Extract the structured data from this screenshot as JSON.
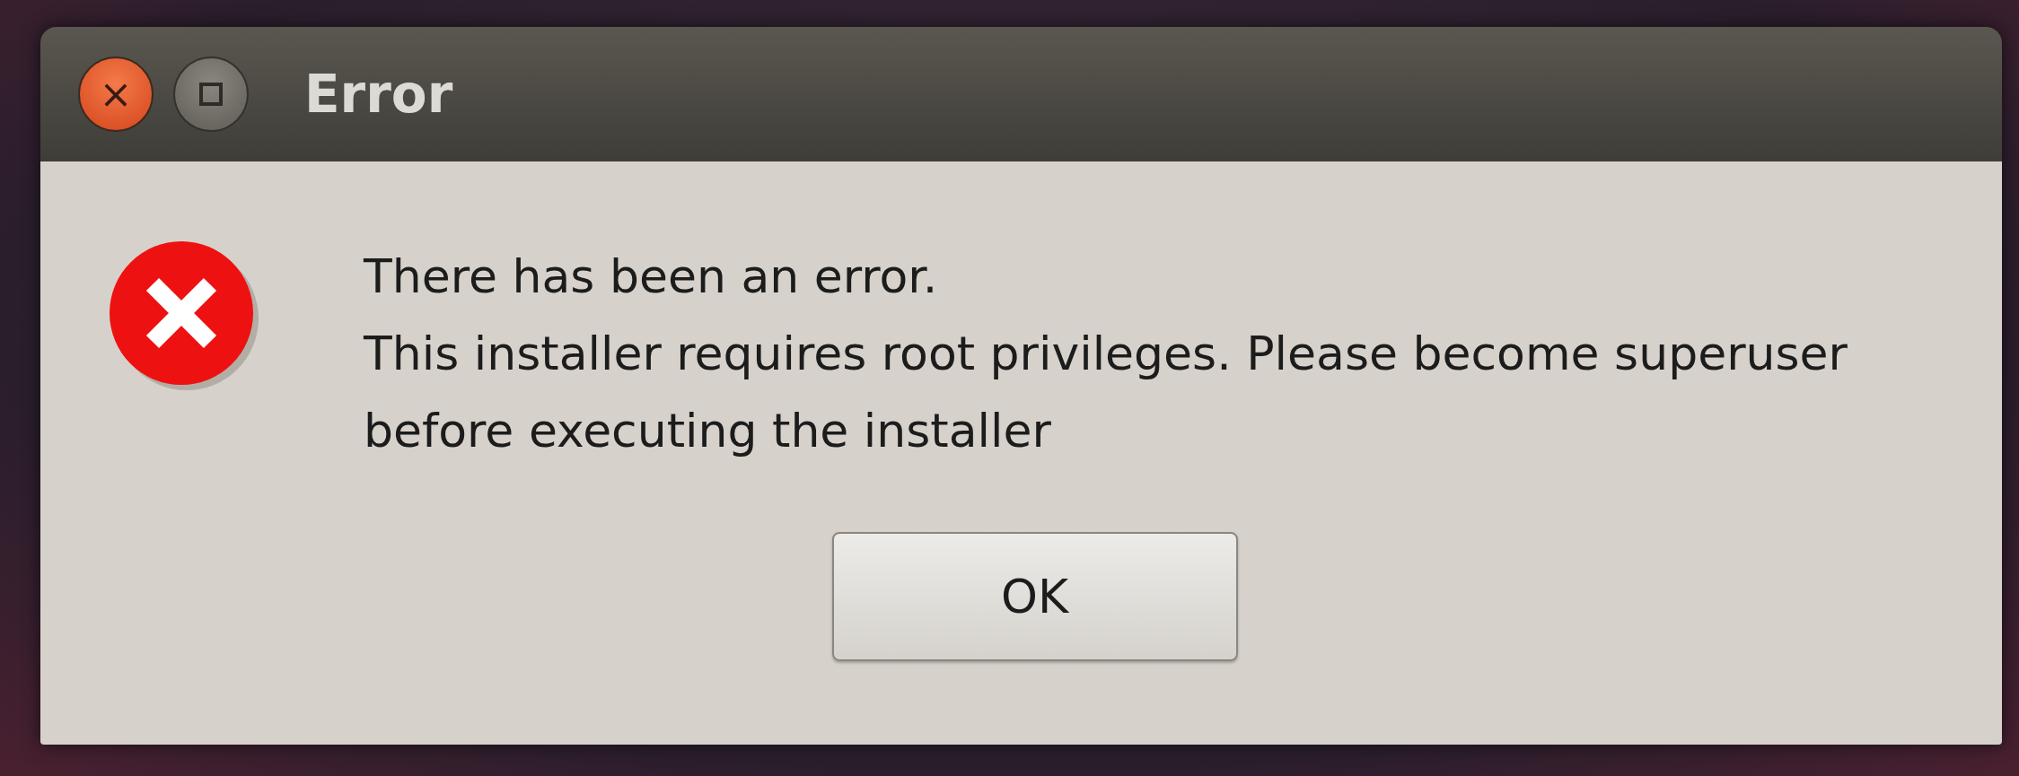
{
  "window": {
    "title": "Error",
    "close_glyph": "×"
  },
  "message": {
    "lines": [
      "There has been an error.",
      "This installer requires root privileges. Please become superuser before executing the installer"
    ]
  },
  "buttons": [
    {
      "label": "OK"
    }
  ]
}
